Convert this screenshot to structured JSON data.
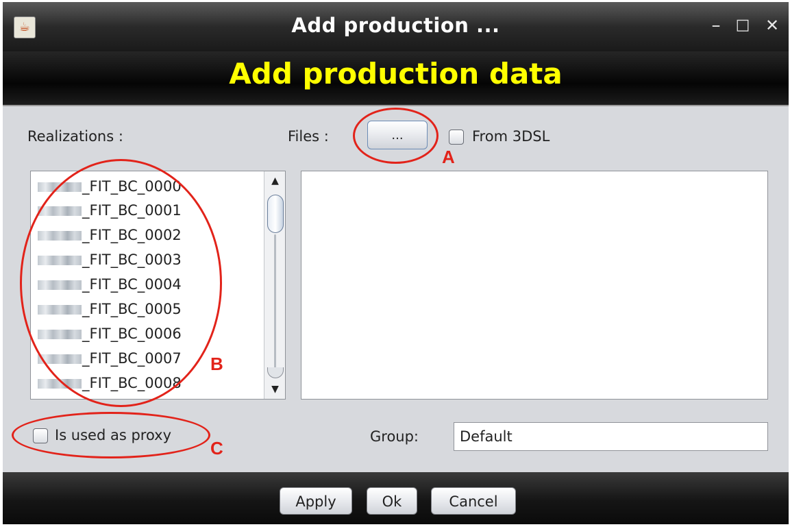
{
  "window": {
    "title": "Add production ...",
    "controls": {
      "minimize": "–",
      "maximize": "□",
      "close": "✕"
    },
    "icon": "java-app-icon"
  },
  "header": {
    "banner_title": "Add production data",
    "banner_color": "#ffff00"
  },
  "realizations": {
    "label": "Realizations :",
    "items": [
      "_FIT_BC_0000",
      "_FIT_BC_0001",
      "_FIT_BC_0002",
      "_FIT_BC_0003",
      "_FIT_BC_0004",
      "_FIT_BC_0005",
      "_FIT_BC_0006",
      "_FIT_BC_0007",
      "_FIT_BC_0008"
    ]
  },
  "files": {
    "label": "Files :",
    "browse_label": "...",
    "from_3dsl_label": "From 3DSL",
    "from_3dsl_checked": false
  },
  "proxy": {
    "label": "Is used as proxy",
    "checked": false
  },
  "group": {
    "label": "Group:",
    "value": "Default"
  },
  "footer": {
    "apply_label": "Apply",
    "ok_label": "Ok",
    "cancel_label": "Cancel"
  },
  "annotations": {
    "a": "A",
    "b": "B",
    "c": "C",
    "color": "#e2231a"
  }
}
